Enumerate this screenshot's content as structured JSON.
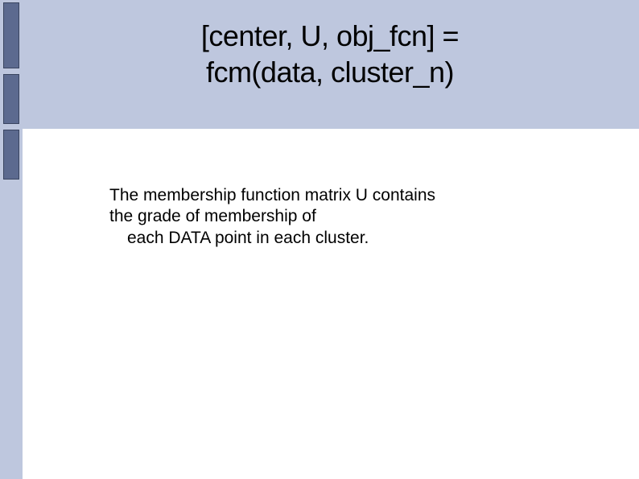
{
  "title": {
    "line1": "[center, U, obj_fcn] =",
    "line2": "fcm(data, cluster_n)"
  },
  "body": {
    "line1": "The membership function matrix U contains",
    "line2": "the grade of membership of",
    "line3": "each DATA point in each cluster."
  }
}
